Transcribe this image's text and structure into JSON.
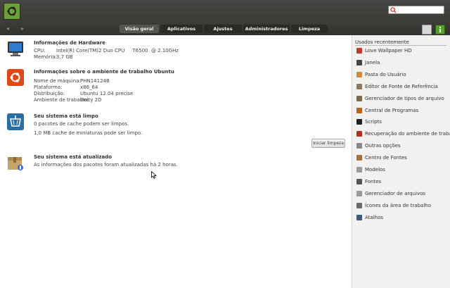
{
  "search": {
    "placeholder": ""
  },
  "nav": {
    "back": "◂",
    "forward": "▸"
  },
  "tabs": [
    "Visão geral",
    "Aplicativos",
    "Ajustes",
    "Administradores",
    "Limpeza"
  ],
  "hardware": {
    "title": "Informações de Hardware",
    "cpu_label": "CPU:",
    "cpu_value": "Intel(R) Core(TM)2 Duo CPU     T6500  @ 2.10GHz",
    "mem_label": "Memória:",
    "mem_value": "3,7 GB"
  },
  "desktop": {
    "title": "Informações sobre o ambiente de trabalho Ubuntu",
    "rows": [
      {
        "label": "Nome de máquina:",
        "value": "PHN14124B"
      },
      {
        "label": "Plataforma:",
        "value": "x86_64"
      },
      {
        "label": "Distribuição:",
        "value": "Ubuntu 12.04 precise"
      },
      {
        "label": "Ambiente de trabalho:",
        "value": "Unity 2D"
      }
    ]
  },
  "clean": {
    "title": "Seu sistema está limpo",
    "line1": "0 pacotes de cache podem ser limpos.",
    "line2": "1,0 MB cache de miniaturas pode ser limpo.",
    "button": "Iniciar limpeza"
  },
  "updated": {
    "title": "Seu sistema está atualizado",
    "line1": "As informações dos pacotes foram atualizadas há 2 horas."
  },
  "sidebar": {
    "title": "Usados recentemente",
    "items": [
      {
        "label": "Love Wallpaper HD",
        "color": "#c0392b"
      },
      {
        "label": "Janela",
        "color": "#444444"
      },
      {
        "label": "Pasta do Usuário",
        "color": "#d08a3a"
      },
      {
        "label": "Editor de Fonte de Referência",
        "color": "#8a7a5a"
      },
      {
        "label": "Gerenciador de tipos de arquivo",
        "color": "#7a6a4a"
      },
      {
        "label": "Central de Programas",
        "color": "#b5651d"
      },
      {
        "label": "Scripts",
        "color": "#222222"
      },
      {
        "label": "Recuperação do ambiente de trabalho",
        "color": "#b03020"
      },
      {
        "label": "Outras opções",
        "color": "#888888"
      },
      {
        "label": "Centro de Fontes",
        "color": "#a07040"
      },
      {
        "label": "Modelos",
        "color": "#999999"
      },
      {
        "label": "Fontes",
        "color": "#555555"
      },
      {
        "label": "Gerenciador de arquivos",
        "color": "#9a9a9a"
      },
      {
        "label": "Ícones da área de trabalho",
        "color": "#6a6a6a"
      },
      {
        "label": "Atalhos",
        "color": "#3a5a8a"
      }
    ]
  }
}
